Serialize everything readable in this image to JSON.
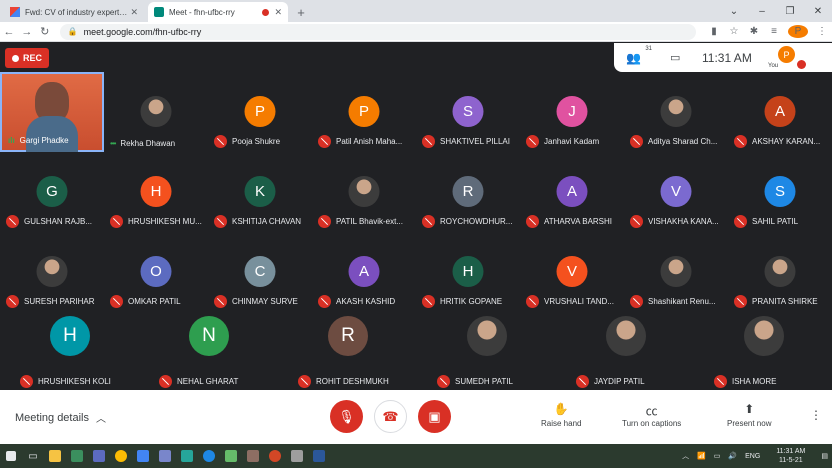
{
  "browser": {
    "tabs": [
      {
        "title": "Fwd: CV of industry experts Add",
        "active": false
      },
      {
        "title": "Meet - fhn-ufbc-rry",
        "active": true
      }
    ],
    "new_tab": "+",
    "url": "meet.google.com/fhn-ufbc-rry",
    "profile_initial": "P"
  },
  "meet": {
    "rec_label": "REC",
    "participant_count": "31",
    "clock": "11:31 AM",
    "you_initial": "P",
    "you_label": "You",
    "speaker": {
      "name": "Gargi Phadke"
    },
    "tiles": [
      {
        "name": "Rekha Dhawan",
        "initial": "",
        "color": "",
        "photo": true,
        "mic": "active"
      },
      {
        "name": "Pooja Shukre",
        "initial": "P",
        "color": "#f57c00",
        "mic": "muted"
      },
      {
        "name": "Patil Anish Maha...",
        "initial": "P",
        "color": "#f57c00",
        "mic": "muted"
      },
      {
        "name": "SHAKTIVEL PILLAI",
        "initial": "S",
        "color": "#8e63ce",
        "mic": "muted"
      },
      {
        "name": "Janhavi Kadam",
        "initial": "J",
        "color": "#e052a0",
        "mic": "muted"
      },
      {
        "name": "Aditya Sharad Ch...",
        "initial": "",
        "color": "",
        "photo": true,
        "mic": "muted"
      },
      {
        "name": "AKSHAY KARAN...",
        "initial": "A",
        "color": "#c5421a",
        "mic": "muted"
      },
      {
        "name": "GULSHAN RAJB...",
        "initial": "G",
        "color": "#1b5e48",
        "mic": "muted"
      },
      {
        "name": "HRUSHIKESH MU...",
        "initial": "H",
        "color": "#f4511e",
        "mic": "muted"
      },
      {
        "name": "KSHITIJA CHAVAN",
        "initial": "K",
        "color": "#1b5e48",
        "mic": "muted"
      },
      {
        "name": "PATIL Bhavik-ext...",
        "initial": "",
        "color": "",
        "photo": true,
        "mic": "muted"
      },
      {
        "name": "ROYCHOWDHUR...",
        "initial": "R",
        "color": "#5f6b7a",
        "mic": "muted"
      },
      {
        "name": "ATHARVA BARSHI",
        "initial": "A",
        "color": "#7b4fbf",
        "mic": "muted"
      },
      {
        "name": "VISHAKHA KANA...",
        "initial": "V",
        "color": "#7b6ad0",
        "mic": "muted"
      },
      {
        "name": "SAHIL PATIL",
        "initial": "S",
        "color": "#1e88e5",
        "mic": "muted"
      },
      {
        "name": "SURESH PARIHAR",
        "initial": "",
        "color": "",
        "photo": true,
        "mic": "muted"
      },
      {
        "name": "OMKAR PATIL",
        "initial": "O",
        "color": "#5c6bc0",
        "mic": "muted"
      },
      {
        "name": "CHINMAY SURVE",
        "initial": "C",
        "color": "#78909c",
        "mic": "muted"
      },
      {
        "name": "AKASH KASHID",
        "initial": "A",
        "color": "#7b4fbf",
        "mic": "muted"
      },
      {
        "name": "HRITIK GOPANE",
        "initial": "H",
        "color": "#1b5e48",
        "mic": "muted"
      },
      {
        "name": "VRUSHALI TAND...",
        "initial": "V",
        "color": "#f4511e",
        "mic": "muted"
      },
      {
        "name": "Shashikant Renu...",
        "initial": "",
        "color": "",
        "photo": true,
        "mic": "muted"
      },
      {
        "name": "PRANITA SHIRKE",
        "initial": "",
        "color": "",
        "photo": true,
        "mic": "muted"
      },
      {
        "name": "HRUSHIKESH KOLI",
        "initial": "H",
        "color": "#0097a7",
        "mic": "muted"
      },
      {
        "name": "NEHAL GHARAT",
        "initial": "N",
        "color": "#2e9e4f",
        "mic": "muted"
      },
      {
        "name": "ROHIT DESHMUKH",
        "initial": "R",
        "color": "#6d4c41",
        "mic": "muted"
      },
      {
        "name": "SUMEDH PATIL",
        "initial": "",
        "color": "",
        "photo": true,
        "mic": "muted"
      },
      {
        "name": "JAYDIP PATIL",
        "initial": "",
        "color": "",
        "photo": true,
        "mic": "muted"
      },
      {
        "name": "ISHA MORE",
        "initial": "",
        "color": "",
        "photo": true,
        "mic": "muted"
      }
    ],
    "controls": {
      "meeting_details": "Meeting details",
      "raise_hand": "Raise hand",
      "captions": "Turn on captions",
      "present": "Present now"
    }
  },
  "taskbar": {
    "language": "ENG",
    "time": "11:31 AM",
    "date": "11-5-21"
  },
  "colors": {
    "accent_red": "#d93025",
    "meet_bg": "#202124",
    "speaker_border": "#8ab4f8"
  }
}
